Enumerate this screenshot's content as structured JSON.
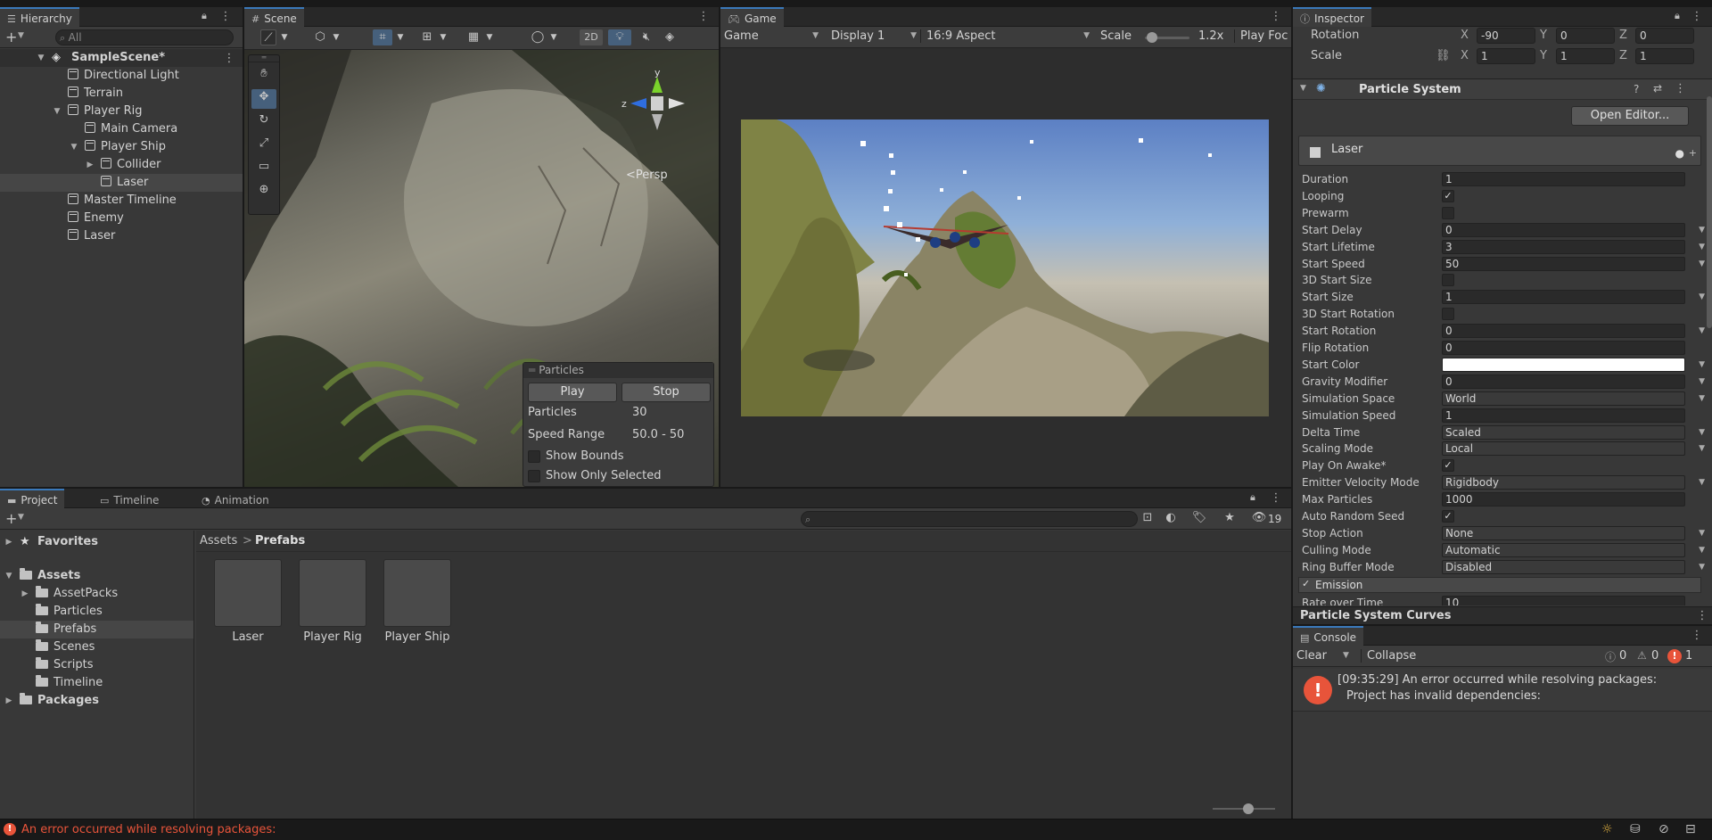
{
  "hierarchy": {
    "tab": "Hierarchy",
    "search_placeholder": "All",
    "items": [
      {
        "label": "SampleScene*"
      },
      {
        "label": "Directional Light"
      },
      {
        "label": "Terrain"
      },
      {
        "label": "Player Rig"
      },
      {
        "label": "Main Camera"
      },
      {
        "label": "Player Ship"
      },
      {
        "label": "Collider"
      },
      {
        "label": "Laser"
      },
      {
        "label": "Master Timeline"
      },
      {
        "label": "Enemy"
      },
      {
        "label": "Laser"
      }
    ]
  },
  "scene": {
    "tab": "Scene",
    "toggle_2d": "2D",
    "persp_label": "Persp",
    "gizmo": {
      "y": "y",
      "z": "z"
    },
    "particles_overlay": {
      "title": "Particles",
      "play": "Play",
      "stop": "Stop",
      "particles_label": "Particles",
      "particles_value": "30",
      "speed_label": "Speed Range",
      "speed_value": "50.0 - 50",
      "show_bounds": "Show Bounds",
      "show_only_selected": "Show Only Selected"
    }
  },
  "game": {
    "tab": "Game",
    "mode": "Game",
    "display": "Display 1",
    "aspect": "16:9 Aspect",
    "scale_label": "Scale",
    "scale_value": "1.2x",
    "scale_fraction": 0.15,
    "play_focused": "Play Foc"
  },
  "inspector": {
    "tab": "Inspector",
    "rotation": {
      "label": "Rotation",
      "x": "-90",
      "y": "0",
      "z": "0"
    },
    "scale": {
      "label": "Scale",
      "x": "1",
      "y": "1",
      "z": "1"
    },
    "axis": {
      "x": "X",
      "y": "Y",
      "z": "Z"
    },
    "component_title": "Particle System",
    "open_editor": "Open Editor...",
    "module_name": "Laser",
    "properties": [
      {
        "label": "Duration",
        "value": "1",
        "kind": "field"
      },
      {
        "label": "Looping",
        "value": "✓",
        "kind": "check"
      },
      {
        "label": "Prewarm",
        "value": "",
        "kind": "check"
      },
      {
        "label": "Start Delay",
        "value": "0",
        "kind": "field-dd"
      },
      {
        "label": "Start Lifetime",
        "value": "3",
        "kind": "field-dd"
      },
      {
        "label": "Start Speed",
        "value": "50",
        "kind": "field-dd"
      },
      {
        "label": "3D Start Size",
        "value": "",
        "kind": "check"
      },
      {
        "label": "Start Size",
        "value": "1",
        "kind": "field-dd"
      },
      {
        "label": "3D Start Rotation",
        "value": "",
        "kind": "check"
      },
      {
        "label": "Start Rotation",
        "value": "0",
        "kind": "field-dd"
      },
      {
        "label": "Flip Rotation",
        "value": "0",
        "kind": "field"
      },
      {
        "label": "Start Color",
        "value": "",
        "kind": "color"
      },
      {
        "label": "Gravity Modifier",
        "value": "0",
        "kind": "field-dd"
      },
      {
        "label": "Simulation Space",
        "value": "World",
        "kind": "select"
      },
      {
        "label": "Simulation Speed",
        "value": "1",
        "kind": "field"
      },
      {
        "label": "Delta Time",
        "value": "Scaled",
        "kind": "select"
      },
      {
        "label": "Scaling Mode",
        "value": "Local",
        "kind": "select"
      },
      {
        "label": "Play On Awake*",
        "value": "✓",
        "kind": "check"
      },
      {
        "label": "Emitter Velocity Mode",
        "value": "Rigidbody",
        "kind": "select"
      },
      {
        "label": "Max Particles",
        "value": "1000",
        "kind": "field"
      },
      {
        "label": "Auto Random Seed",
        "value": "✓",
        "kind": "check"
      },
      {
        "label": "Stop Action",
        "value": "None",
        "kind": "select"
      },
      {
        "label": "Culling Mode",
        "value": "Automatic",
        "kind": "select"
      },
      {
        "label": "Ring Buffer Mode",
        "value": "Disabled",
        "kind": "select"
      }
    ],
    "emission_label": "Emission",
    "rate_over_time_label": "Rate over Time",
    "rate_over_time_value": "10",
    "curves_title": "Particle System Curves"
  },
  "console": {
    "tab": "Console",
    "clear": "Clear",
    "collapse": "Collapse",
    "count_info": "0",
    "count_warn": "0",
    "count_error": "1",
    "message_line1": "[09:35:29] An error occurred while resolving packages:",
    "message_line2": "Project has invalid dependencies:"
  },
  "project": {
    "tabs": [
      "Project",
      "Timeline",
      "Animation"
    ],
    "hidden_count": "19",
    "favorites": "Favorites",
    "assets": "Assets",
    "folders": [
      "AssetPacks",
      "Particles",
      "Prefabs",
      "Scenes",
      "Scripts",
      "Timeline"
    ],
    "packages": "Packages",
    "breadcrumb": [
      "Assets",
      "Prefabs"
    ],
    "files": [
      "Laser",
      "Player Rig",
      "Player Ship"
    ]
  },
  "status_bar": {
    "message": "An error occurred while resolving packages:"
  },
  "colors": {
    "accent": "#3a79bb",
    "error": "#e8543a",
    "panel": "#383838"
  }
}
